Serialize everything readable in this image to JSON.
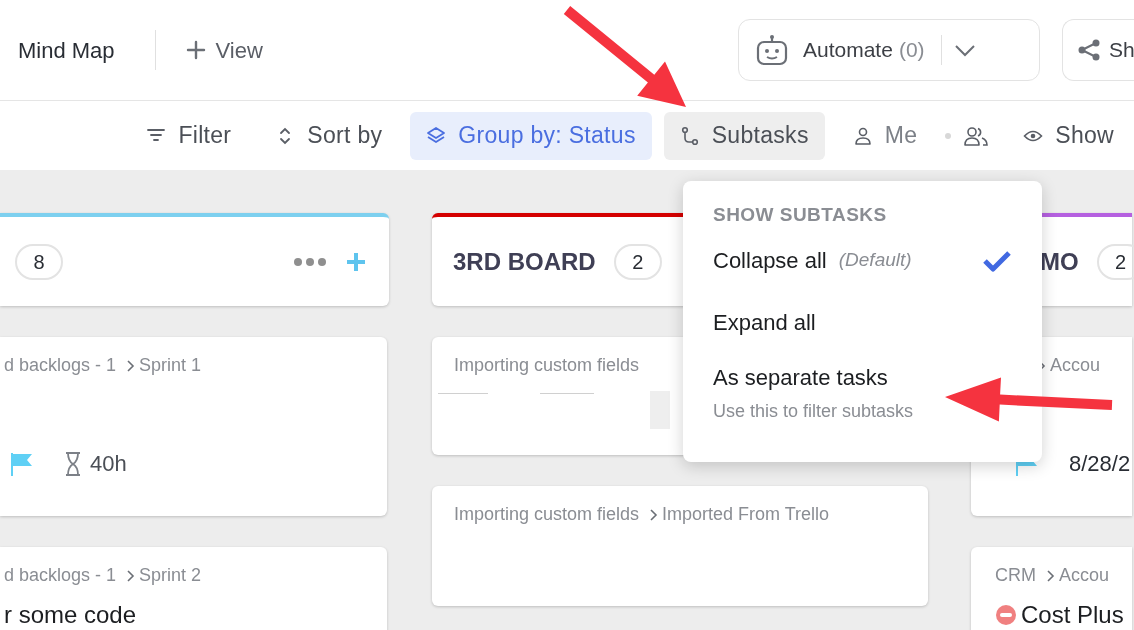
{
  "view_bar": {
    "current_view": "Mind Map",
    "add_view": "View"
  },
  "automate": {
    "label": "Automate",
    "count": "(0)"
  },
  "share": {
    "label": "Sh"
  },
  "toolbar": [
    {
      "kind": "filter",
      "label": "Filter",
      "active": false,
      "open": false
    },
    {
      "kind": "sort",
      "label": "Sort by",
      "active": false,
      "open": false
    },
    {
      "kind": "group",
      "label": "Group by: Status",
      "active": true,
      "open": false
    },
    {
      "kind": "subtasks",
      "label": "Subtasks",
      "active": false,
      "open": true
    },
    {
      "kind": "me",
      "label": "Me",
      "active": false,
      "open": false
    },
    {
      "kind": "show",
      "label": "Show",
      "active": false,
      "open": false
    }
  ],
  "board": {
    "columns": [
      {
        "count": "8",
        "color": "#7dd0ef",
        "cards": [
          {
            "path": "d backlogs - 1",
            "list": "Sprint 1",
            "flagged": true,
            "time": "40h"
          },
          {
            "path": "d backlogs - 1",
            "list": "Sprint 2",
            "title": "r some code"
          }
        ]
      },
      {
        "title": "3RD BOARD",
        "count": "2",
        "color": "#d40000",
        "cards": [
          {
            "path": "Importing custom fields",
            "loading": true
          },
          {
            "path": "Importing custom fields",
            "list": "Imported From Trello"
          }
        ]
      },
      {
        "title": "MO",
        "count": "2",
        "color": "#b560e0",
        "cards": [
          {
            "list": "Accou",
            "flagged": true,
            "date": "8/28/2"
          },
          {
            "path": "CRM",
            "list": "Accou",
            "blocked": true,
            "title": "Cost Plus"
          }
        ]
      }
    ]
  },
  "menu": {
    "heading": "SHOW SUBTASKS",
    "items": [
      {
        "label": "Collapse all",
        "note": "(Default)",
        "selected": true
      },
      {
        "label": "Expand all",
        "selected": false
      },
      {
        "label": "As separate tasks",
        "hint": "Use this to filter subtasks",
        "selected": false
      }
    ]
  }
}
